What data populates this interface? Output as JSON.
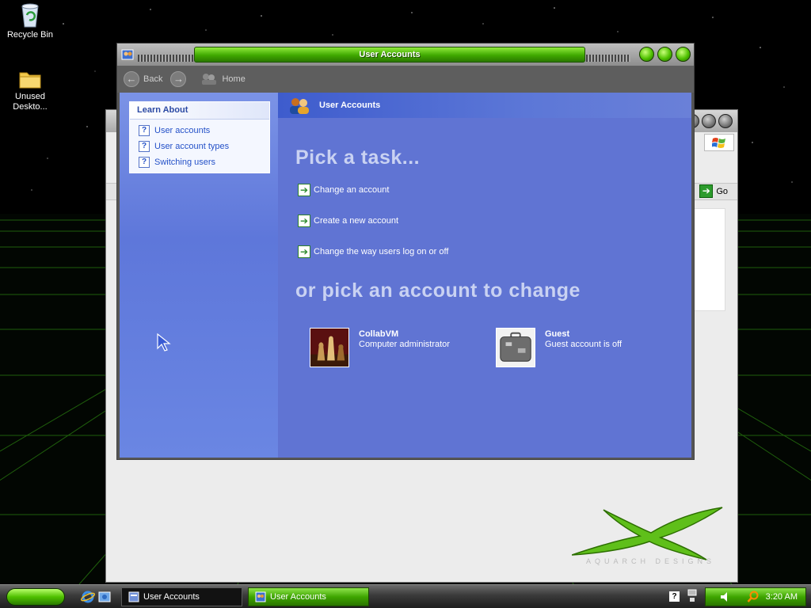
{
  "desktop": {
    "icons": [
      {
        "label": "Recycle Bin"
      },
      {
        "label": "Unused Deskto..."
      }
    ]
  },
  "bg_window": {
    "go_label": "Go",
    "tagline": "AQUARCH DESIGNS"
  },
  "window": {
    "title": "User Accounts",
    "toolbar": {
      "back": "Back",
      "home": "Home"
    },
    "learn_about": {
      "heading": "Learn About",
      "items": [
        "User accounts",
        "User account types",
        "Switching users"
      ]
    },
    "header": "User Accounts",
    "pick_task_heading": "Pick a task...",
    "tasks": [
      "Change an account",
      "Create a new account",
      "Change the way users log on or off"
    ],
    "pick_account_heading": "or pick an account to change",
    "accounts": [
      {
        "name": "CollabVM",
        "desc": "Computer administrator"
      },
      {
        "name": "Guest",
        "desc": "Guest account is off"
      }
    ]
  },
  "taskbar": {
    "buttons": [
      "User Accounts",
      "User Accounts"
    ],
    "clock": "3:20 AM",
    "help_glyph": "?"
  },
  "colors": {
    "accent_green": "#3fa800",
    "panel_blue": "#6074d3",
    "link_blue": "#2451c8"
  }
}
